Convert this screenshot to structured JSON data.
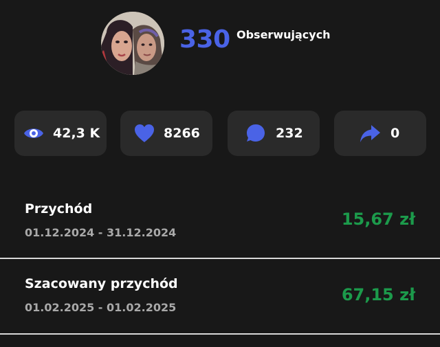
{
  "profile": {
    "followers_count": "330",
    "followers_label": "Obserwujących"
  },
  "stats": {
    "views": {
      "value": "42,3 K",
      "icon": "eye-icon"
    },
    "likes": {
      "value": "8266",
      "icon": "heart-icon"
    },
    "comments": {
      "value": "232",
      "icon": "comment-icon"
    },
    "shares": {
      "value": "0",
      "icon": "share-icon"
    }
  },
  "revenue": [
    {
      "title": "Przychód",
      "date_range": "01.12.2024 - 31.12.2024",
      "amount": "15,67 zł"
    },
    {
      "title": "Szacowany przychód",
      "date_range": "01.02.2025 - 01.02.2025",
      "amount": "67,15 zł"
    }
  ],
  "colors": {
    "background": "#181818",
    "tile": "#2a2a2a",
    "accent_blue": "#4a63e6",
    "amount_green": "#1c9a4b",
    "muted_text": "#a9a9a9"
  }
}
